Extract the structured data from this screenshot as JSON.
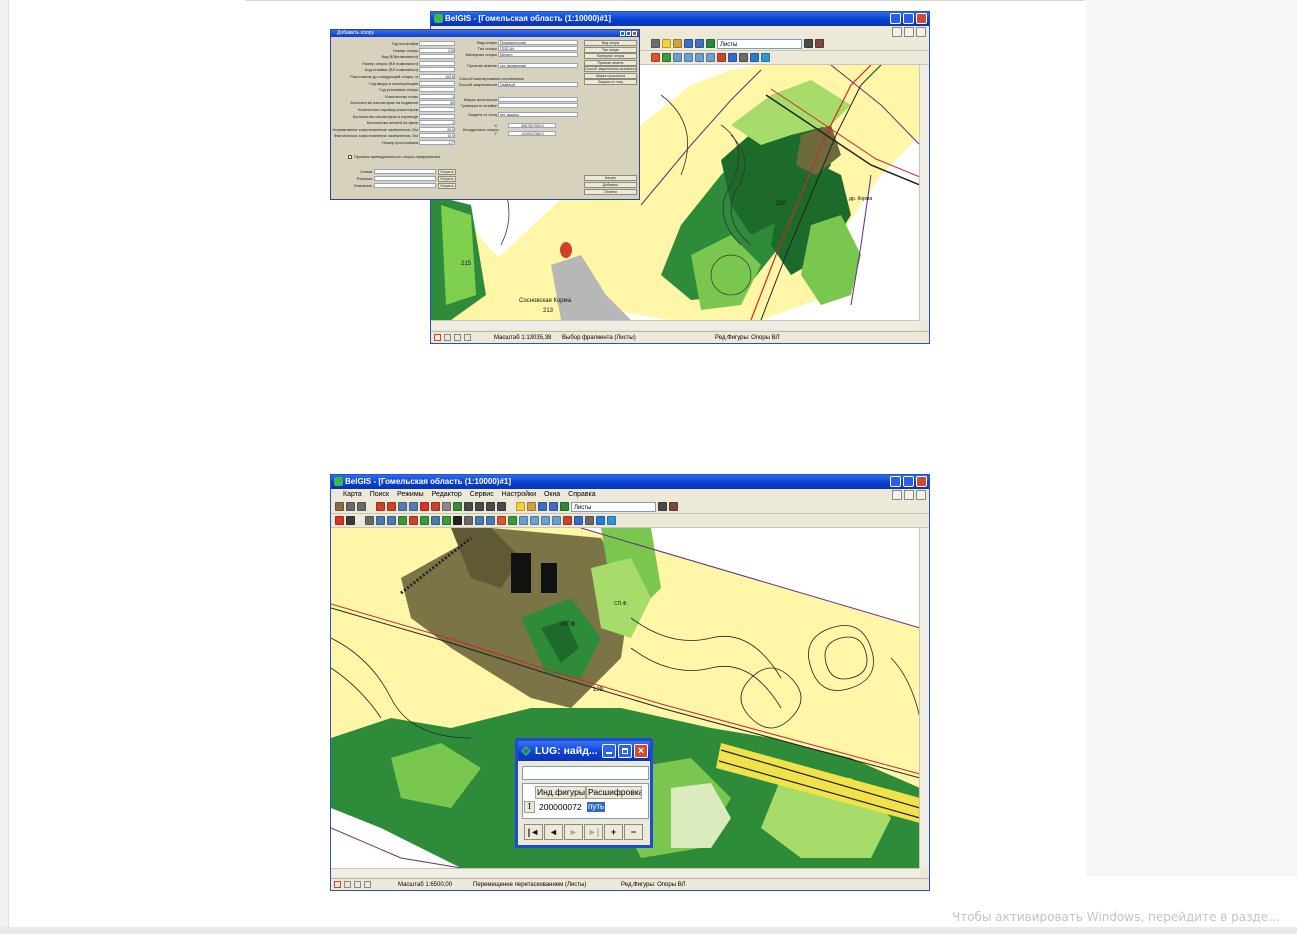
{
  "top_window": {
    "title": "BelGIS - [Гомельская область (1:10000)#1]",
    "sheets_combo": "Листы",
    "status": {
      "scale": "Масштаб 1:13035,38",
      "mode": "Выбор фрагмента (Листы)",
      "edit": "Ред.Фигуры: Опоры ВЛ"
    }
  },
  "bottom_window": {
    "title": "BelGIS - [Гомельская область (1:10000)#1]",
    "menu": [
      "Карта",
      "Поиск",
      "Режимы",
      "Редактор",
      "Сервис",
      "Настройки",
      "Окна",
      "Справка"
    ],
    "sheets_combo": "Листы",
    "status": {
      "scale": "Масштаб 1:6500,00",
      "mode": "Перемещение перетаскиванием (Листы)",
      "edit": "Ред.Фигуры: Опоры ВЛ"
    }
  },
  "map_labels": {
    "top_label_a": "Сосновская Корма",
    "top_label_b": "213",
    "top_label_c": "215",
    "top_label_d": "200",
    "top_label_e": "др. Корма",
    "bottom_label_a": "МТ.Ф",
    "bottom_label_b": "199",
    "bottom_label_c": "СП.Ф."
  },
  "dialog": {
    "title": "Добавить опору",
    "left_fields": [
      {
        "label": "Год постройки",
        "value": ""
      },
      {
        "label": "Номер опоры",
        "value": "219"
      },
      {
        "label": "Код ВЛ(номинальн)",
        "value": ""
      },
      {
        "label": "Номер опоры (ВЛ номинальн)",
        "value": ""
      },
      {
        "label": "Код отпайки (ВЛ номинальн)",
        "value": ""
      },
      {
        "label": "Расстояние до следующей опоры, м",
        "value": "102.6"
      },
      {
        "label": "Год ввода в эксплуатацию",
        "value": ""
      },
      {
        "label": "Год установки опоры",
        "value": ""
      },
      {
        "label": "Количество стоек",
        "value": "1"
      },
      {
        "label": "Количество изоляторов на подвеске",
        "value": "30"
      },
      {
        "label": "Количество гирлянд изоляторов",
        "value": ""
      },
      {
        "label": "Количество изоляторов в гирлянде",
        "value": ""
      },
      {
        "label": "Количество ветвей на фазе",
        "value": "1"
      },
      {
        "label": "Нормативное сопротивление заземления, Ом",
        "value": "20.0"
      },
      {
        "label": "Фактическое сопротивление заземления, Ом",
        "value": "19.0"
      },
      {
        "label": "Номер фотоснимка",
        "value": "177"
      }
    ],
    "checkbox_label": "Признак принадлежности опоры предприятию",
    "file_fields": [
      {
        "label": "Схема:",
        "button": "Открыть"
      },
      {
        "label": "Рисунок:",
        "button": "Открыть"
      },
      {
        "label": "Описание:",
        "button": "Открыть"
      }
    ],
    "right_fields": [
      {
        "label": "Вид опоры",
        "value": "Промежуточная"
      },
      {
        "label": "Тип опоры",
        "value": "П220-3Н"
      },
      {
        "label": "Материал опоры",
        "value": "Металл"
      },
      {
        "label": "Признак земель",
        "value": "лес (древесная)"
      },
      {
        "label": "Способ закрепления",
        "value": "Свайный"
      },
      {
        "label": "Марка грозотроса",
        "value": ""
      },
      {
        "label": "Траверса в отпайке",
        "value": ""
      },
      {
        "label": "Защита от птиц",
        "value": "нет защиты"
      },
      {
        "label": "X",
        "value": "5557837583.0"
      },
      {
        "label": "Y",
        "value": "1030047389.0"
      }
    ],
    "section_label": "Координаты опоры:",
    "method_label": "Способ монтирования отключения",
    "side_buttons": [
      "Вид опоры",
      "Тип опоры",
      "Материал опоры",
      "Признак земель",
      "Способ закрепления заземления",
      "Марка грозотроса",
      "Защита от птиц"
    ],
    "bottom_buttons": [
      "Начать",
      "Добавить",
      "Отмена"
    ]
  },
  "lug_dialog": {
    "title": "LUG: найд...",
    "search_value": "",
    "columns": [
      "Инд.фигуры",
      "Расшифровка"
    ],
    "row_marker": "I",
    "rows": [
      {
        "id": "200000072",
        "decode": "путь"
      }
    ]
  },
  "watermark": "Чтобы активировать Windows, перейдите в разде..."
}
